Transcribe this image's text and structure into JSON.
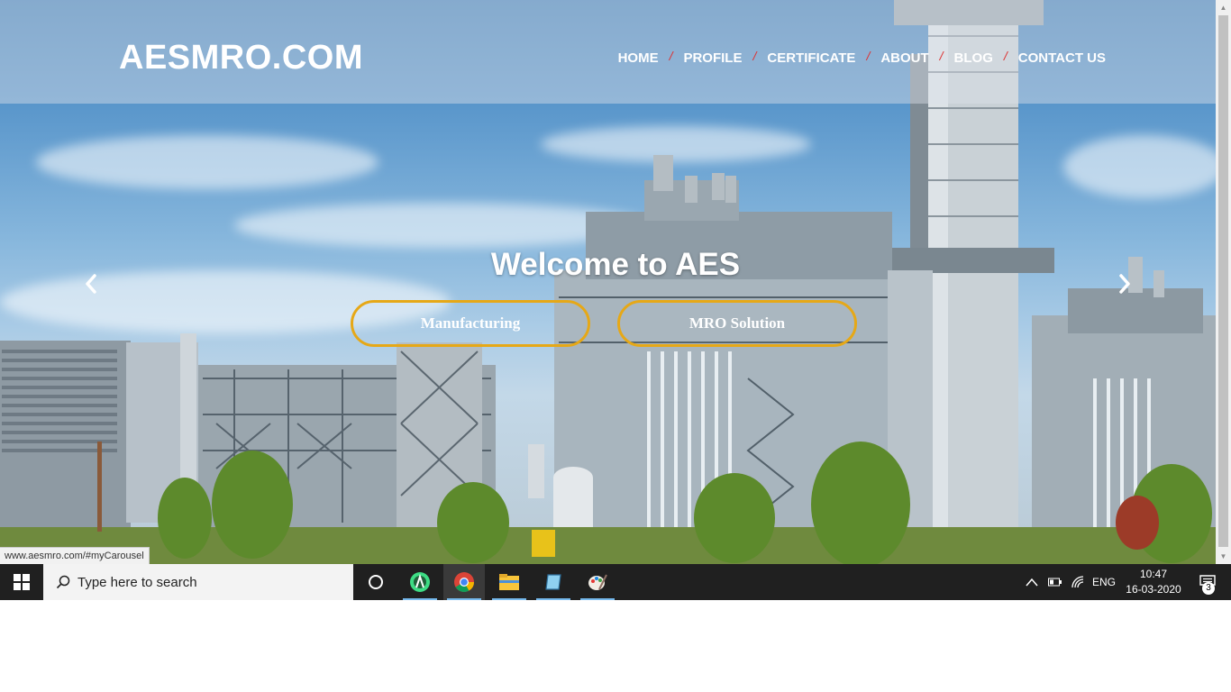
{
  "site": {
    "logo": "AESMRO.COM",
    "nav": [
      {
        "label": "HOME"
      },
      {
        "label": "PROFILE"
      },
      {
        "label": "CERTIFICATE"
      },
      {
        "label": "ABOUT"
      },
      {
        "label": "BLOG"
      },
      {
        "label": "CONTACT US"
      }
    ],
    "nav_separator": "/",
    "hero": {
      "title": "Welcome to AES",
      "buttons": [
        {
          "label": "Manufacturing"
        },
        {
          "label": "MRO Solution"
        }
      ],
      "prev_icon": "chevron-left-icon",
      "next_icon": "chevron-right-icon"
    }
  },
  "browser": {
    "status_url": "www.aesmro.com/#myCarousel"
  },
  "taskbar": {
    "search_placeholder": "Type here to search",
    "apps": [
      "cortana-icon",
      "android-studio-icon",
      "chrome-icon",
      "file-explorer-icon",
      "notepad-icon",
      "paint-icon"
    ],
    "language": "ENG",
    "time": "10:47",
    "date": "16-03-2020",
    "notifications": "3"
  },
  "colors": {
    "accent_button_border": "#e6a817",
    "nav_separator": "#dd3333",
    "taskbar": "#202020"
  }
}
